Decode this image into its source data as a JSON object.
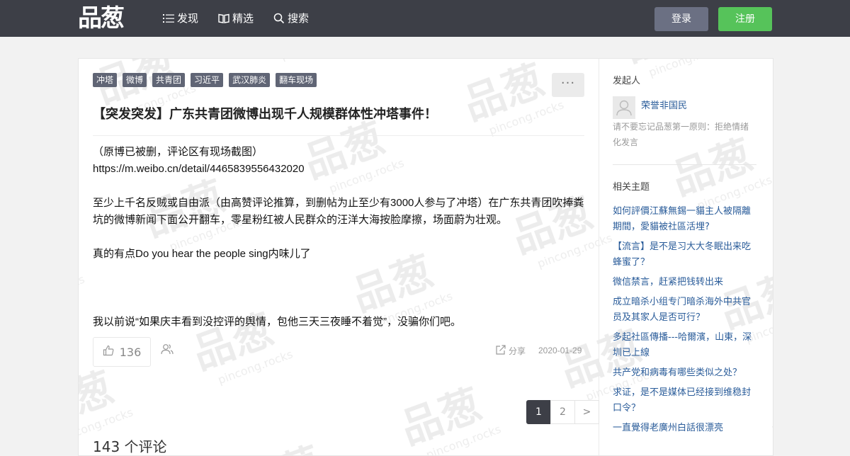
{
  "header": {
    "logo_text": "品葱",
    "nav": [
      {
        "label": "发现",
        "icon": "list-icon"
      },
      {
        "label": "精选",
        "icon": "book-icon"
      },
      {
        "label": "搜索",
        "icon": "search-icon"
      }
    ],
    "login_label": "登录",
    "register_label": "注册"
  },
  "post": {
    "tags": [
      "冲塔",
      "微博",
      "共青团",
      "习近平",
      "武汉肺炎",
      "翻车现场"
    ],
    "more_label": "···",
    "title": "【突发突发】广东共青团微博出现千人规模群体性冲塔事件！",
    "paragraphs": [
      "（原博已被删，评论区有现场截图）",
      "https://m.weibo.cn/detail/4465839556432020",
      "",
      "至少上千名反贼或自由派（由高赞评论推算，到删帖为止至少有3000人参与了冲塔）在广东共青团吹捧粪坑的微博新闻下面公开翻车，零星粉红被人民群众的汪洋大海按脸摩擦，场面蔚为壮观。",
      "",
      "真的有点Do you hear the people sing内味儿了",
      "",
      "",
      "",
      "我以前说“如果庆丰看到没控评的舆情，包他三天三夜睡不着觉”，没骗你们吧。"
    ],
    "likes": "136",
    "share_label": "分享",
    "date": "2020-01-29"
  },
  "pagination": {
    "pages": [
      "1",
      "2"
    ],
    "next": ">"
  },
  "comments": {
    "count_label": "143 个评论"
  },
  "sidebar": {
    "author_heading": "发起人",
    "author_name": "荣誉非国民",
    "author_note": "请不要忘记品葱第一原则：拒绝情绪化发言",
    "related_heading": "相关主题",
    "related": [
      "如何評價江蘇無錫一貓主人被隔離期間，愛貓被社區活埋?",
      "【流言】是不是习大大冬眠出来吃蜂蜜了？",
      "微信禁言，赶紧把钱转出来",
      "成立暗杀小组专门暗杀海外中共官员及其家人是否可行？",
      "多起社區傳播---哈爾濱，山東，深圳已上線",
      "共产党和病毒有哪些类似之处？",
      "求证，是不是媒体已经接到维稳封口令？",
      "一直覺得老廣州白話很漂亮"
    ]
  },
  "watermark": {
    "text": "品葱",
    "sub": "pincong.rocks"
  },
  "colors": {
    "topbar": "#3d3f47",
    "login": "#6b7083",
    "register": "#56c35a",
    "link": "#2a5c9a",
    "tag": "#606575"
  }
}
